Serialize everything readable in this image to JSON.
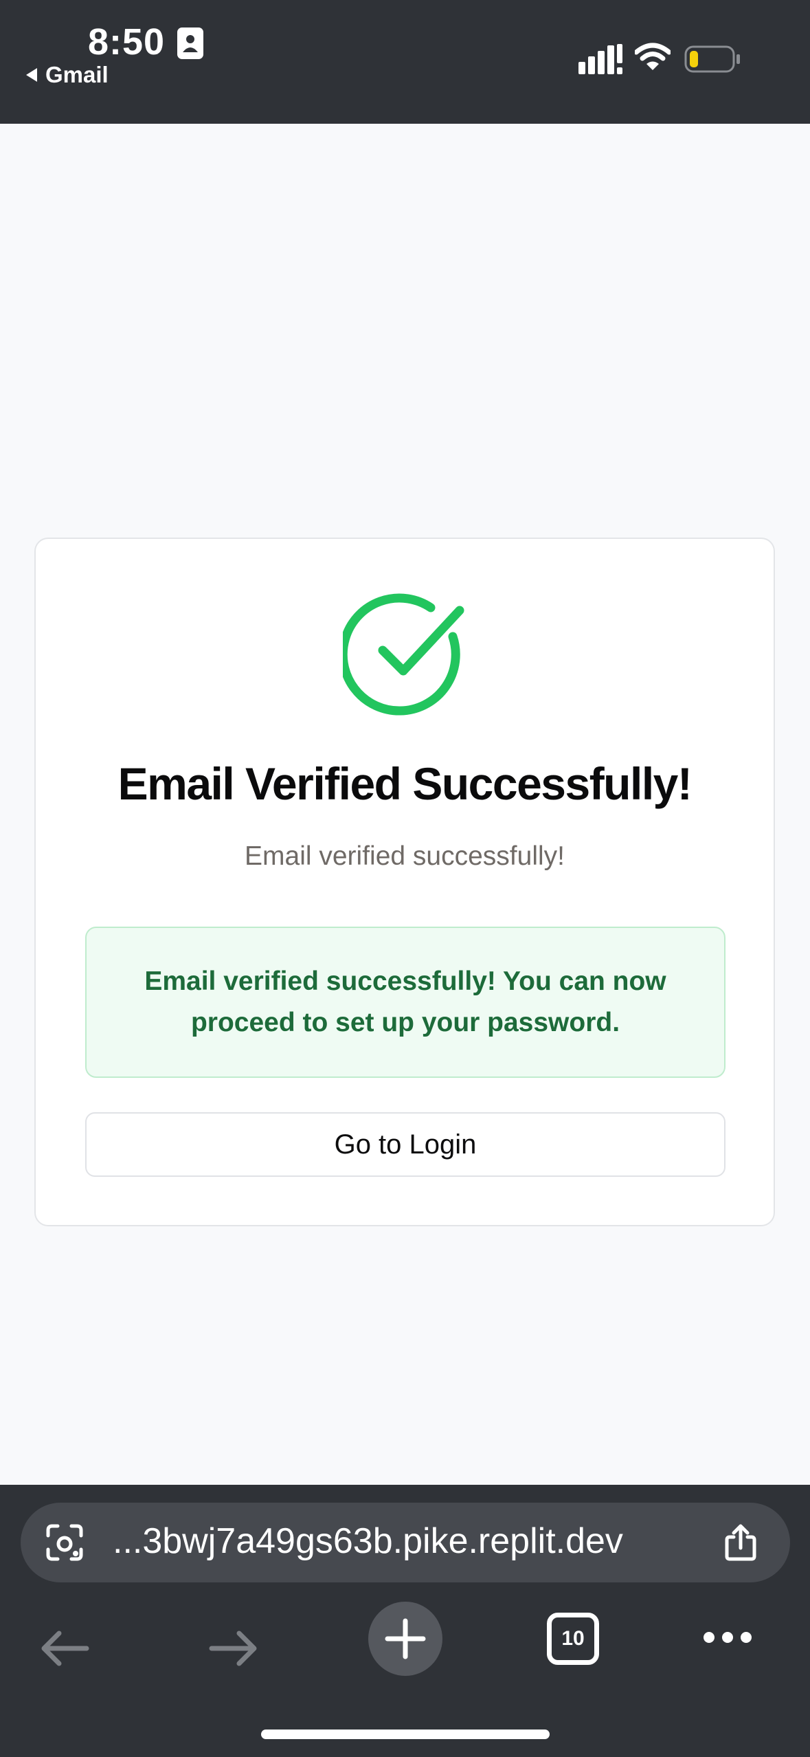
{
  "status_bar": {
    "time": "8:50",
    "back_app": "Gmail",
    "battery_color": "#f4d00b"
  },
  "card": {
    "icon": "check-circle-icon",
    "accent_color": "#22c55e",
    "title": "Email Verified Successfully!",
    "subtitle": "Email verified successfully!",
    "alert_message": "Email verified successfully! You can now proceed to set up your password.",
    "login_button_label": "Go to Login"
  },
  "browser": {
    "url": "...3bwj7a49gs63b.pike.replit.dev",
    "tab_count": "10"
  }
}
